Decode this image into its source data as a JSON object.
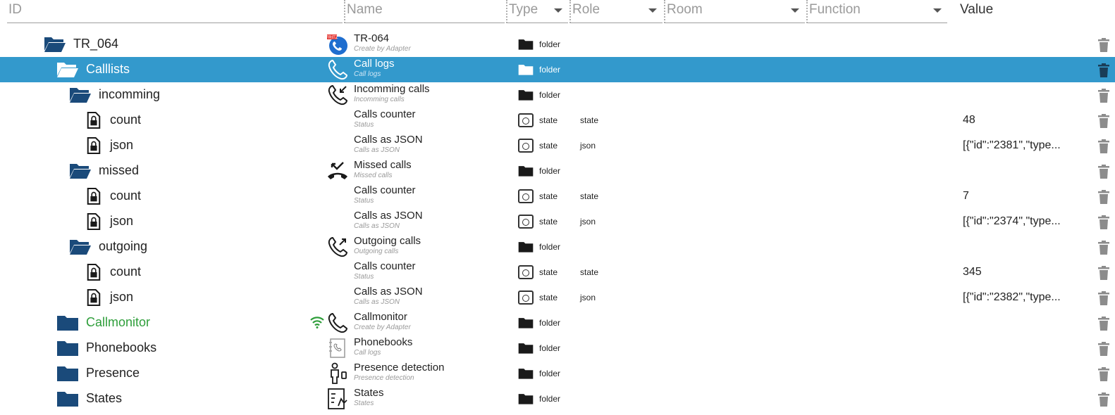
{
  "header": {
    "id": "ID",
    "name": "Name",
    "type": "Type",
    "role": "Role",
    "room": "Room",
    "function": "Function",
    "value": "Value"
  },
  "rows": [
    {
      "id": "TR_064",
      "indent": 0,
      "icon": "folder-open-icon",
      "name": "TR-064",
      "sub": "Create by Adapter",
      "name_icon": "fritzbox-logo",
      "type": "folder",
      "role": "",
      "value": ""
    },
    {
      "id": "Calllists",
      "indent": 1,
      "icon": "folder-open-icon",
      "name": "Call logs",
      "sub": "Call logs",
      "name_icon": "phone-icon",
      "type": "folder",
      "role": "",
      "value": "",
      "selected": true
    },
    {
      "id": "incomming",
      "indent": 2,
      "icon": "folder-open-icon",
      "name": "Incomming calls",
      "sub": "Incomming calls",
      "name_icon": "phone-incoming-icon",
      "type": "folder",
      "role": "",
      "value": ""
    },
    {
      "id": "count",
      "indent": 3,
      "icon": "file-lock-icon",
      "name": "Calls counter",
      "sub": "Status",
      "name_icon": "",
      "type": "state",
      "role": "state",
      "value": "48"
    },
    {
      "id": "json",
      "indent": 3,
      "icon": "file-lock-icon",
      "name": "Calls as JSON",
      "sub": "Calls as JSON",
      "name_icon": "",
      "type": "state",
      "role": "json",
      "value": "[{\"id\":\"2381\",\"type..."
    },
    {
      "id": "missed",
      "indent": 2,
      "icon": "folder-open-icon",
      "name": "Missed calls",
      "sub": "Missed calls",
      "name_icon": "phone-missed-icon",
      "type": "folder",
      "role": "",
      "value": ""
    },
    {
      "id": "count",
      "indent": 3,
      "icon": "file-lock-icon",
      "name": "Calls counter",
      "sub": "Status",
      "name_icon": "",
      "type": "state",
      "role": "state",
      "value": "7"
    },
    {
      "id": "json",
      "indent": 3,
      "icon": "file-lock-icon",
      "name": "Calls as JSON",
      "sub": "Calls as JSON",
      "name_icon": "",
      "type": "state",
      "role": "json",
      "value": "[{\"id\":\"2374\",\"type..."
    },
    {
      "id": "outgoing",
      "indent": 2,
      "icon": "folder-open-icon",
      "name": "Outgoing calls",
      "sub": "Outgoing calls",
      "name_icon": "phone-outgoing-icon",
      "type": "folder",
      "role": "",
      "value": ""
    },
    {
      "id": "count",
      "indent": 3,
      "icon": "file-lock-icon",
      "name": "Calls counter",
      "sub": "Status",
      "name_icon": "",
      "type": "state",
      "role": "state",
      "value": "345"
    },
    {
      "id": "json",
      "indent": 3,
      "icon": "file-lock-icon",
      "name": "Calls as JSON",
      "sub": "Calls as JSON",
      "name_icon": "",
      "type": "state",
      "role": "json",
      "value": "[{\"id\":\"2382\",\"type..."
    },
    {
      "id": "Callmonitor",
      "indent": 1,
      "icon": "folder-closed-icon",
      "name": "Callmonitor",
      "sub": "Create by Adapter",
      "name_icon": "phone-icon",
      "type": "folder",
      "role": "",
      "value": "",
      "green": true,
      "wifi": true
    },
    {
      "id": "Phonebooks",
      "indent": 1,
      "icon": "folder-closed-icon",
      "name": "Phonebooks",
      "sub": "Call logs",
      "name_icon": "phonebook-icon",
      "type": "folder",
      "role": "",
      "value": ""
    },
    {
      "id": "Presence",
      "indent": 1,
      "icon": "folder-closed-icon",
      "name": "Presence detection",
      "sub": "Presence detection",
      "name_icon": "presence-icon",
      "type": "folder",
      "role": "",
      "value": ""
    },
    {
      "id": "States",
      "indent": 1,
      "icon": "folder-closed-icon",
      "name": "States",
      "sub": "States",
      "name_icon": "states-icon",
      "type": "folder",
      "role": "",
      "value": ""
    }
  ],
  "colors": {
    "selected": "#3399cc",
    "folder": "#1a4a7a",
    "online": "#2e9e3a",
    "trash": "#8c8c8c"
  }
}
